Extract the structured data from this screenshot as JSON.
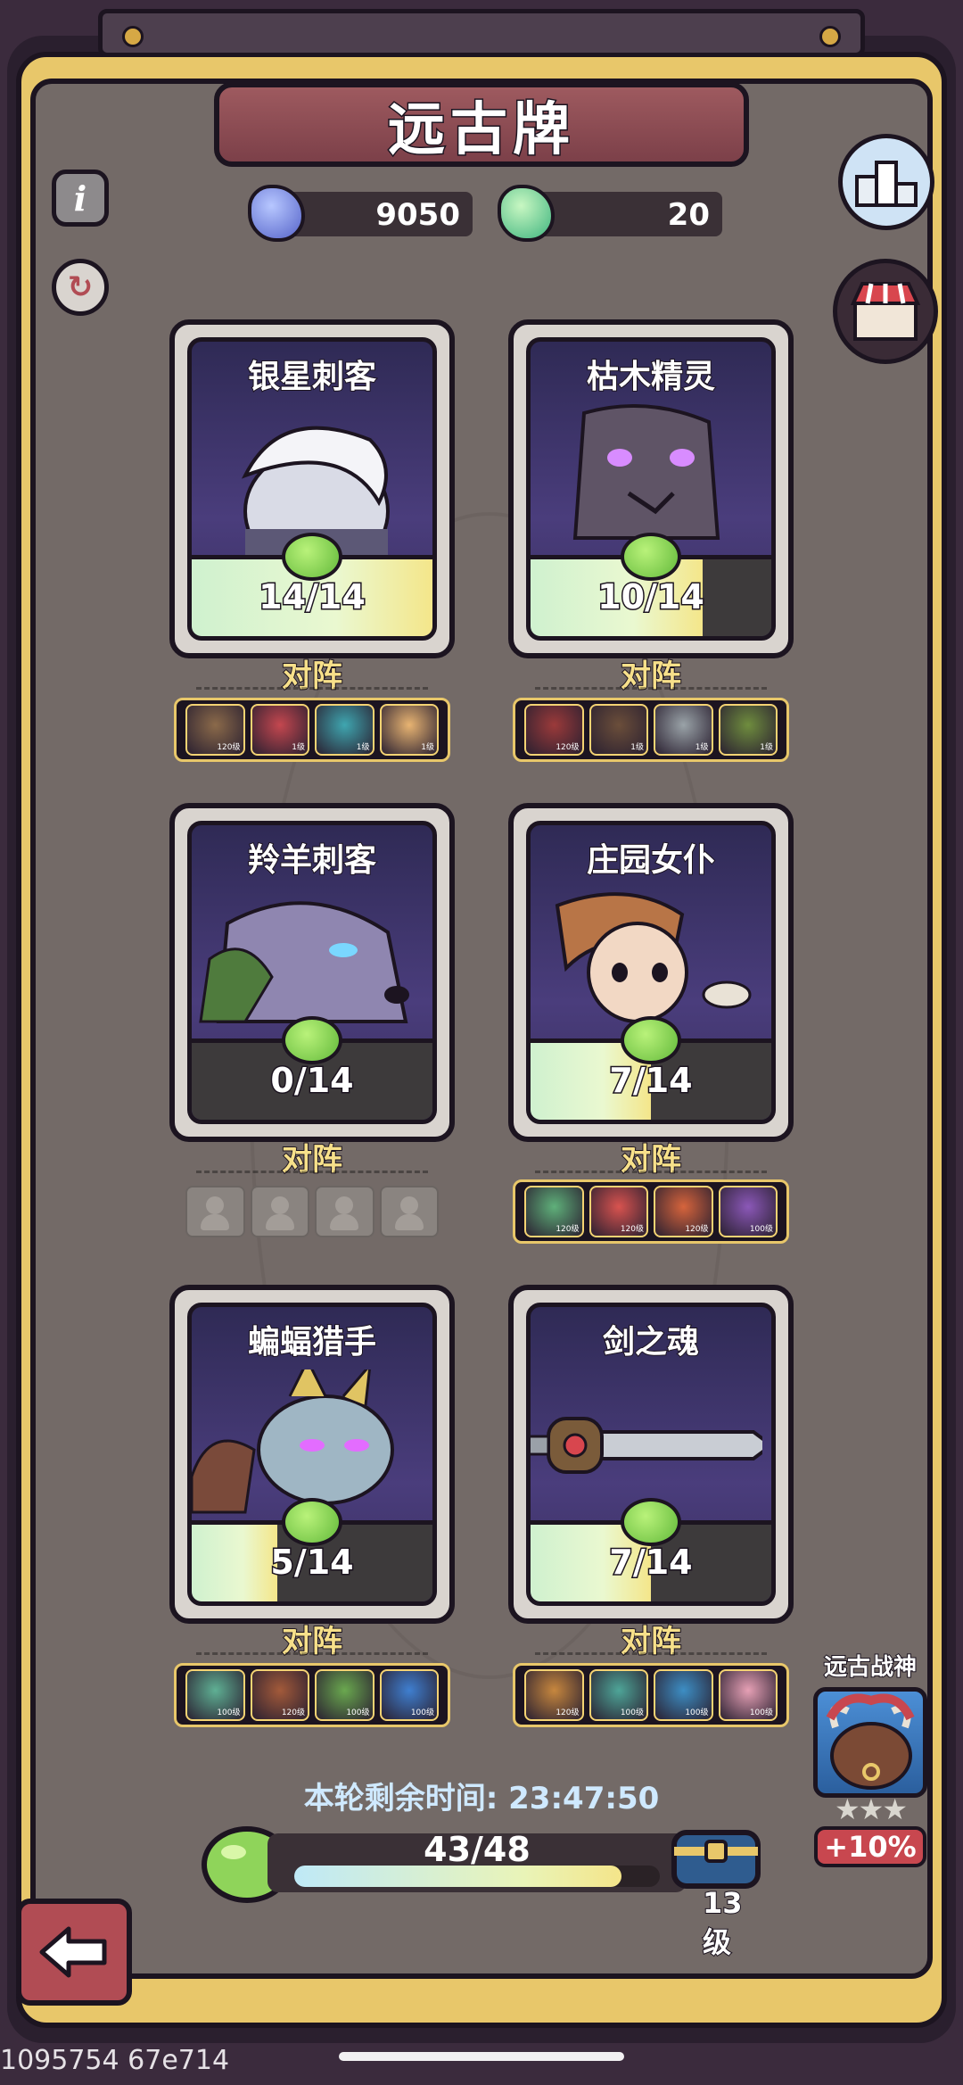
{
  "title": "远古牌",
  "currencies": [
    {
      "icon": "blue-crystal-icon",
      "value": "9050"
    },
    {
      "icon": "green-crystal-icon",
      "value": "20"
    }
  ],
  "cards": [
    {
      "name": "银星刺客",
      "count": "14/14",
      "progress": 1.0,
      "lineup_label": "对阵",
      "art_colors": [
        "#d9dbe6",
        "#5c5876"
      ],
      "heroes": [
        {
          "lvl": "120级",
          "color": "#8b6a4a"
        },
        {
          "lvl": "1级",
          "color": "#c4474f"
        },
        {
          "lvl": "1级",
          "color": "#3fa6b0"
        },
        {
          "lvl": "1级",
          "color": "#e8b472"
        }
      ]
    },
    {
      "name": "枯木精灵",
      "count": "10/14",
      "progress": 0.714,
      "lineup_label": "对阵",
      "art_colors": [
        "#5f5466",
        "#3c3446"
      ],
      "heroes": [
        {
          "lvl": "120级",
          "color": "#9b3a3a"
        },
        {
          "lvl": "1级",
          "color": "#6b4e3a"
        },
        {
          "lvl": "1级",
          "color": "#9aa3a8"
        },
        {
          "lvl": "1级",
          "color": "#6f8d3e"
        }
      ]
    },
    {
      "name": "羚羊刺客",
      "count": "0/14",
      "progress": 0.0,
      "lineup_label": "对阵",
      "art_colors": [
        "#8f86b0",
        "#4f7b3d"
      ],
      "heroes": []
    },
    {
      "name": "庄园女仆",
      "count": "7/14",
      "progress": 0.5,
      "lineup_label": "对阵",
      "art_colors": [
        "#b87547",
        "#f2d8c4"
      ],
      "heroes": [
        {
          "lvl": "120级",
          "color": "#5fb07a"
        },
        {
          "lvl": "120级",
          "color": "#d8534f"
        },
        {
          "lvl": "120级",
          "color": "#d6643c"
        },
        {
          "lvl": "100级",
          "color": "#8b58b8"
        }
      ]
    },
    {
      "name": "蝙蝠猎手",
      "count": "5/14",
      "progress": 0.357,
      "lineup_label": "对阵",
      "art_colors": [
        "#9fb6c4",
        "#e0c463"
      ],
      "heroes": [
        {
          "lvl": "100级",
          "color": "#5fb094"
        },
        {
          "lvl": "120级",
          "color": "#a35a3a"
        },
        {
          "lvl": "100级",
          "color": "#6aa84f"
        },
        {
          "lvl": "100级",
          "color": "#3f7fd0"
        }
      ]
    },
    {
      "name": "剑之魂",
      "count": "7/14",
      "progress": 0.5,
      "lineup_label": "对阵",
      "art_colors": [
        "#9aa0a8",
        "#7a5b3a"
      ],
      "heroes": [
        {
          "lvl": "120级",
          "color": "#c7873e"
        },
        {
          "lvl": "100级",
          "color": "#4ea598"
        },
        {
          "lvl": "100级",
          "color": "#3d8ec4"
        },
        {
          "lvl": "100级",
          "color": "#e6a0b5"
        }
      ]
    }
  ],
  "timer": "本轮剩余时间: 23:47:50",
  "xp": {
    "text": "43/48",
    "progress": 0.896,
    "level": "13级"
  },
  "promo": {
    "title": "远古战神",
    "stars": "★★★",
    "bonus": "+10%"
  },
  "watermark": "1095754 67e714"
}
